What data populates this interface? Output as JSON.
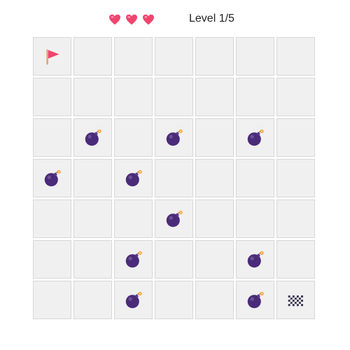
{
  "hud": {
    "lives": 3,
    "level_text": "Level 1/5"
  },
  "colors": {
    "heart": "#f0456f",
    "cell_bg": "#f0f0f0",
    "cell_border": "#d7d7d7",
    "bomb": "#4a2b7a",
    "fuse_spark": "#f5a03a",
    "flag": "#f0456f",
    "goal_dark": "#3a3550"
  },
  "grid": {
    "rows": 7,
    "cols": 7,
    "start": {
      "row": 0,
      "col": 0,
      "icon": "start-flag-icon"
    },
    "goal": {
      "row": 6,
      "col": 6,
      "icon": "checkered-flag-icon"
    },
    "bombs": [
      {
        "row": 2,
        "col": 1
      },
      {
        "row": 2,
        "col": 3
      },
      {
        "row": 2,
        "col": 5
      },
      {
        "row": 3,
        "col": 0
      },
      {
        "row": 3,
        "col": 2
      },
      {
        "row": 4,
        "col": 3
      },
      {
        "row": 5,
        "col": 2
      },
      {
        "row": 5,
        "col": 5
      },
      {
        "row": 6,
        "col": 2
      },
      {
        "row": 6,
        "col": 5
      }
    ]
  }
}
